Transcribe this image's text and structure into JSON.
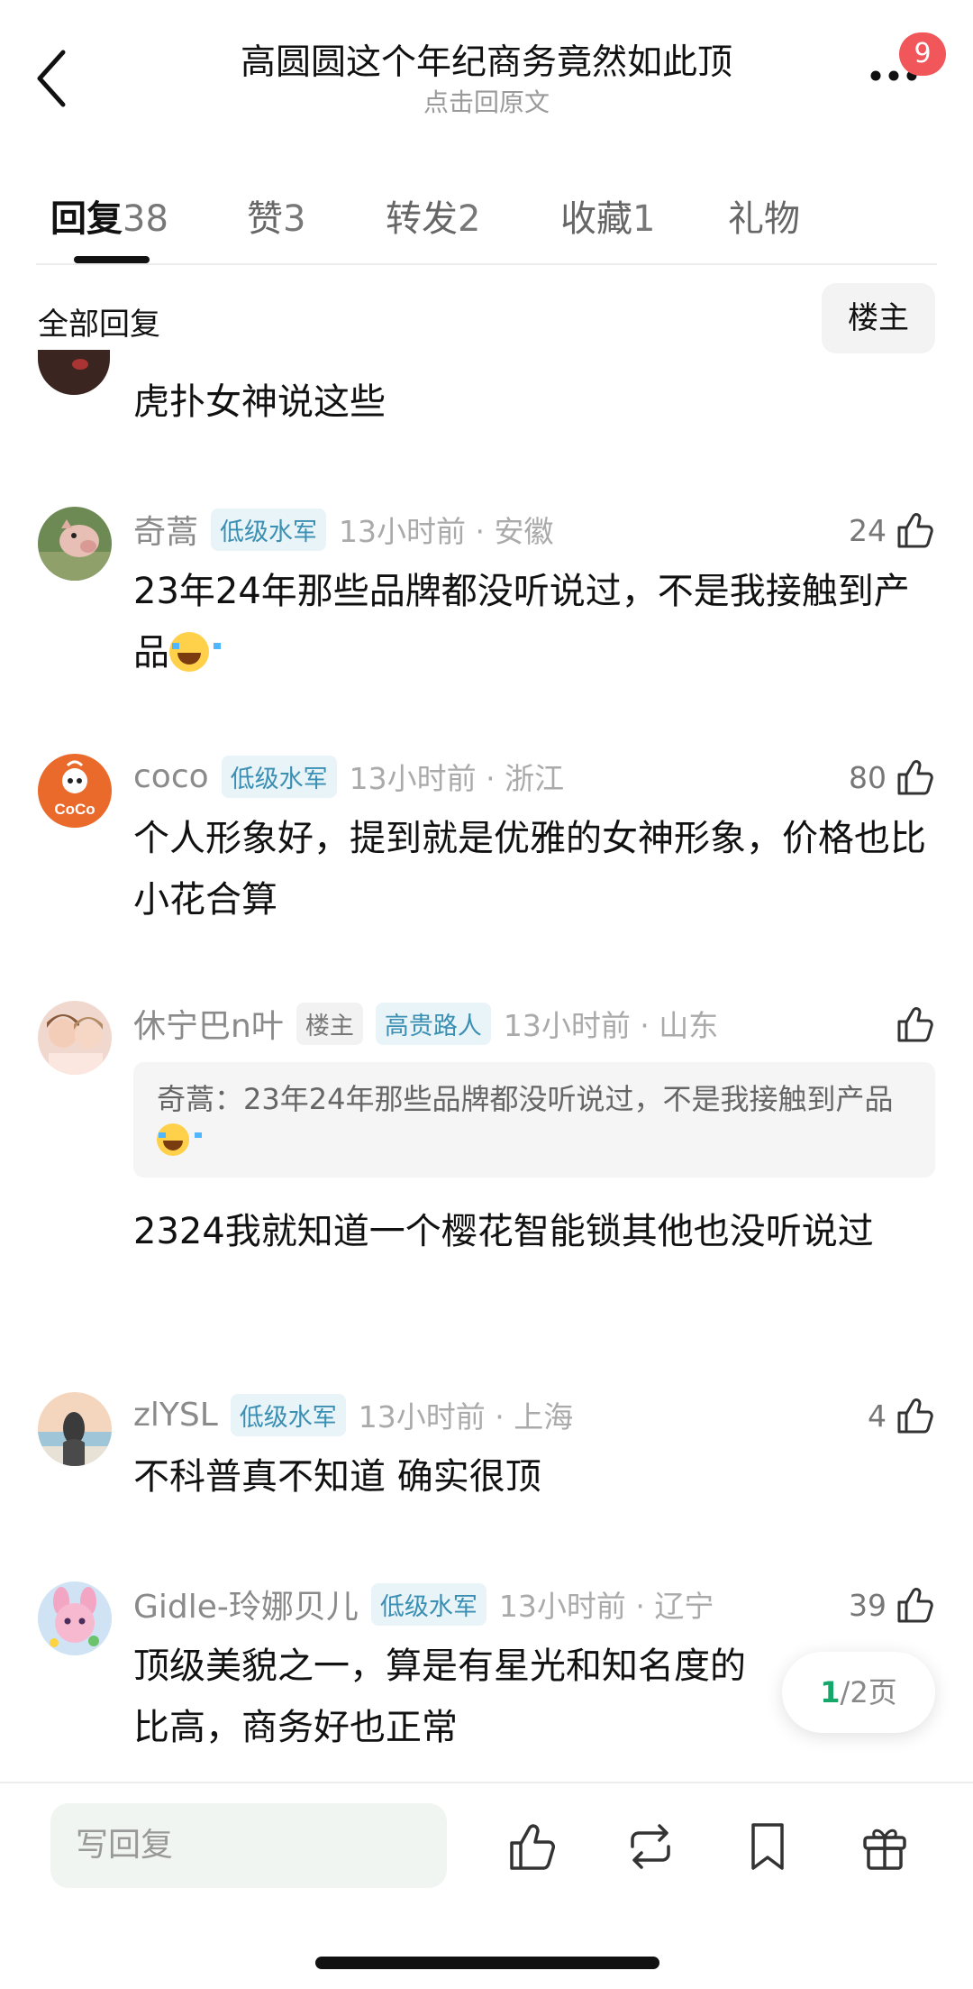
{
  "header": {
    "title": "高圆圆这个年纪商务竟然如此顶",
    "subtitle": "点击回原文",
    "notification_count": "9"
  },
  "tabs": [
    {
      "label": "回复",
      "count": "38",
      "active": true
    },
    {
      "label": "赞",
      "count": "3"
    },
    {
      "label": "转发",
      "count": "2"
    },
    {
      "label": "收藏",
      "count": "1"
    },
    {
      "label": "礼物",
      "count": ""
    }
  ],
  "filter": {
    "all_label": "全部回复",
    "op_label": "楼主"
  },
  "comments": [
    {
      "text": "虎扑女神说这些"
    },
    {
      "username": "奇蒿",
      "tag": "低级水军",
      "time": "13小时前 · 安徽",
      "likes": "24",
      "text": "23年24年那些品牌都没听说过，不是我接触到产品"
    },
    {
      "username": "coco",
      "tag": "低级水军",
      "time": "13小时前 · 浙江",
      "likes": "80",
      "avatar_text": "CoCo",
      "text": "个人形象好，提到就是优雅的女神形象，价格也比小花合算"
    },
    {
      "username": "休宁巴n叶",
      "op_tag": "楼主",
      "tag": "高贵路人",
      "time": "13小时前 · 山东",
      "likes": "",
      "quote": "奇蒿：23年24年那些品牌都没听说过，不是我接触到产品",
      "text": "2324我就知道一个樱花智能锁其他也没听说过"
    },
    {
      "username": "zlYSL",
      "tag": "低级水军",
      "time": "13小时前 · 上海",
      "likes": "4",
      "text": "不科普真不知道 确实很顶"
    },
    {
      "username": "Gidle-玲娜贝儿",
      "tag": "低级水军",
      "time": "13小时前 · 辽宁",
      "likes": "39",
      "text": "顶级美貌之一，算是有星光和知名度的",
      "text2": "比高，商务好也正常"
    }
  ],
  "pager": {
    "current": "1",
    "total": "/2页"
  },
  "bottom_bar": {
    "reply_placeholder": "写回复"
  },
  "icons": {
    "back": "chevron-left-icon",
    "more": "more-icon",
    "like": "thumbs-up-icon",
    "repost": "repost-icon",
    "bookmark": "bookmark-icon",
    "gift": "gift-icon"
  },
  "colors": {
    "badge": "#f0565a",
    "tag_text": "#3a8fb3",
    "tag_bg": "#e9f4f9",
    "pager_current": "#16a76a"
  }
}
